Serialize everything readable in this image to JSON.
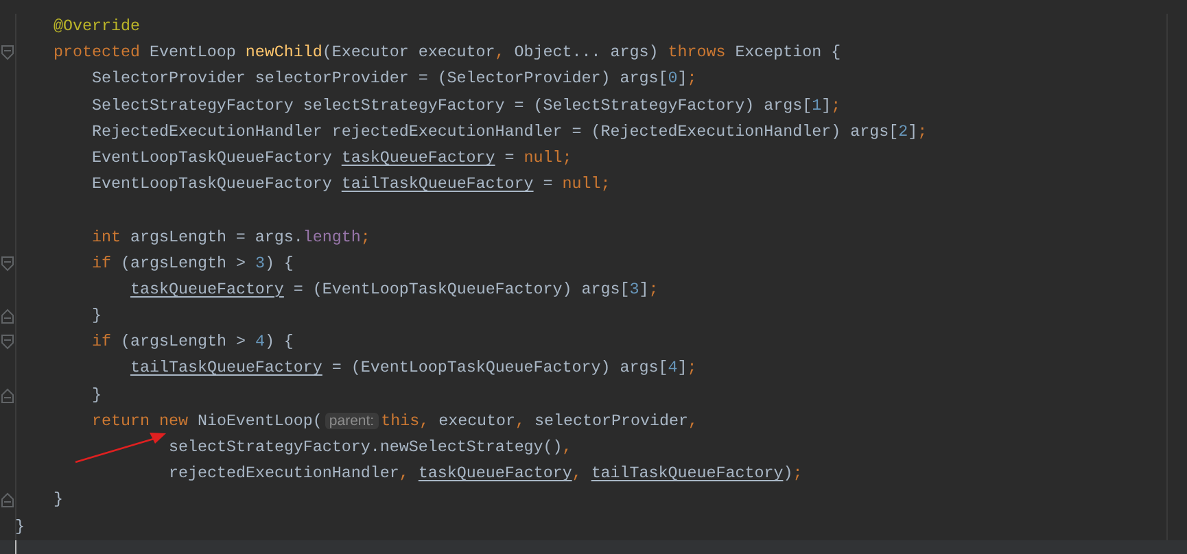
{
  "editor": {
    "block": {
      "foldable": false,
      "closing": [
        {
          "kind": "plain",
          "t": "}"
        }
      ],
      "children": [
        {
          "foldable": false,
          "tokens": [
            {
              "kind": "ann",
              "t": "@Override"
            }
          ]
        },
        {
          "foldable": true,
          "tokens": [
            {
              "kind": "kw",
              "t": "protected "
            },
            {
              "kind": "plain",
              "t": "EventLoop "
            },
            {
              "kind": "method",
              "t": "newChild"
            },
            {
              "kind": "plain",
              "t": "(Executor executor"
            },
            {
              "kind": "kw",
              "t": ", "
            },
            {
              "kind": "plain",
              "t": "Object... args) "
            },
            {
              "kind": "kw",
              "t": "throws "
            },
            {
              "kind": "plain",
              "t": "Exception {"
            }
          ],
          "closing": [
            {
              "kind": "plain",
              "t": "}"
            }
          ],
          "children": [
            {
              "foldable": false,
              "tokens": [
                {
                  "kind": "plain",
                  "t": "SelectorProvider selectorProvider = (SelectorProvider) args["
                },
                {
                  "kind": "num",
                  "t": "0"
                },
                {
                  "kind": "plain",
                  "t": "]"
                },
                {
                  "kind": "kw",
                  "t": ";"
                }
              ]
            },
            {
              "foldable": false,
              "tokens": [
                {
                  "kind": "plain",
                  "t": "SelectStrategyFactory selectStrategyFactory = (SelectStrategyFactory) args["
                },
                {
                  "kind": "num",
                  "t": "1"
                },
                {
                  "kind": "plain",
                  "t": "]"
                },
                {
                  "kind": "kw",
                  "t": ";"
                }
              ]
            },
            {
              "foldable": false,
              "tokens": [
                {
                  "kind": "plain",
                  "t": "RejectedExecutionHandler rejectedExecutionHandler = (RejectedExecutionHandler) args["
                },
                {
                  "kind": "num",
                  "t": "2"
                },
                {
                  "kind": "plain",
                  "t": "]"
                },
                {
                  "kind": "kw",
                  "t": ";"
                }
              ]
            },
            {
              "foldable": false,
              "tokens": [
                {
                  "kind": "plain",
                  "t": "EventLoopTaskQueueFactory "
                },
                {
                  "kind": "var",
                  "t": "taskQueueFactory"
                },
                {
                  "kind": "plain",
                  "t": " = "
                },
                {
                  "kind": "kw",
                  "t": "null;"
                }
              ]
            },
            {
              "foldable": false,
              "tokens": [
                {
                  "kind": "plain",
                  "t": "EventLoopTaskQueueFactory "
                },
                {
                  "kind": "var",
                  "t": "tailTaskQueueFactory"
                },
                {
                  "kind": "plain",
                  "t": " = "
                },
                {
                  "kind": "kw",
                  "t": "null;"
                }
              ]
            },
            {
              "foldable": false
            },
            {
              "foldable": false,
              "tokens": [
                {
                  "kind": "kw",
                  "t": "int "
                },
                {
                  "kind": "plain",
                  "t": "argsLength = args."
                },
                {
                  "kind": "field",
                  "t": "length"
                },
                {
                  "kind": "kw",
                  "t": ";"
                }
              ]
            },
            {
              "foldable": true,
              "tokens": [
                {
                  "kind": "kw",
                  "t": "if "
                },
                {
                  "kind": "plain",
                  "t": "(argsLength > "
                },
                {
                  "kind": "num",
                  "t": "3"
                },
                {
                  "kind": "plain",
                  "t": ") {"
                }
              ],
              "closing": [
                {
                  "kind": "plain",
                  "t": "}"
                }
              ],
              "children": [
                {
                  "foldable": false,
                  "tokens": [
                    {
                      "kind": "var",
                      "t": "taskQueueFactory"
                    },
                    {
                      "kind": "plain",
                      "t": " = (EventLoopTaskQueueFactory) args["
                    },
                    {
                      "kind": "num",
                      "t": "3"
                    },
                    {
                      "kind": "plain",
                      "t": "]"
                    },
                    {
                      "kind": "kw",
                      "t": ";"
                    }
                  ]
                }
              ]
            },
            {
              "foldable": true,
              "tokens": [
                {
                  "kind": "kw",
                  "t": "if "
                },
                {
                  "kind": "plain",
                  "t": "(argsLength > "
                },
                {
                  "kind": "num",
                  "t": "4"
                },
                {
                  "kind": "plain",
                  "t": ") {"
                }
              ],
              "closing": [
                {
                  "kind": "plain",
                  "t": "}"
                }
              ],
              "children": [
                {
                  "foldable": false,
                  "tokens": [
                    {
                      "kind": "var",
                      "t": "tailTaskQueueFactory"
                    },
                    {
                      "kind": "plain",
                      "t": " = (EventLoopTaskQueueFactory) args["
                    },
                    {
                      "kind": "num",
                      "t": "4"
                    },
                    {
                      "kind": "plain",
                      "t": "]"
                    },
                    {
                      "kind": "kw",
                      "t": ";"
                    }
                  ]
                }
              ]
            },
            {
              "foldable": false,
              "tokens": [
                {
                  "kind": "kw",
                  "t": "return new "
                },
                {
                  "kind": "plain",
                  "t": "NioEventLoop("
                },
                {
                  "kind": "hint",
                  "t": "parent:"
                },
                {
                  "kind": "kw",
                  "t": "this, "
                },
                {
                  "kind": "plain",
                  "t": "executor"
                },
                {
                  "kind": "kw",
                  "t": ", "
                },
                {
                  "kind": "plain",
                  "t": "selectorProvider"
                },
                {
                  "kind": "kw",
                  "t": ","
                }
              ],
              "wrapped": [
                {
                  "foldable": false,
                  "tokens": [
                    {
                      "kind": "plain",
                      "t": "selectStrategyFactory.newSelectStrategy()"
                    },
                    {
                      "kind": "kw",
                      "t": ","
                    }
                  ]
                },
                {
                  "foldable": false,
                  "tokens": [
                    {
                      "kind": "plain",
                      "t": "rejectedExecutionHandler"
                    },
                    {
                      "kind": "kw",
                      "t": ", "
                    },
                    {
                      "kind": "var",
                      "t": "taskQueueFactory"
                    },
                    {
                      "kind": "kw",
                      "t": ", "
                    },
                    {
                      "kind": "var",
                      "t": "tailTaskQueueFactory"
                    },
                    {
                      "kind": "plain",
                      "t": ")"
                    },
                    {
                      "kind": "kw",
                      "t": ";"
                    }
                  ]
                }
              ]
            }
          ]
        }
      ]
    }
  }
}
